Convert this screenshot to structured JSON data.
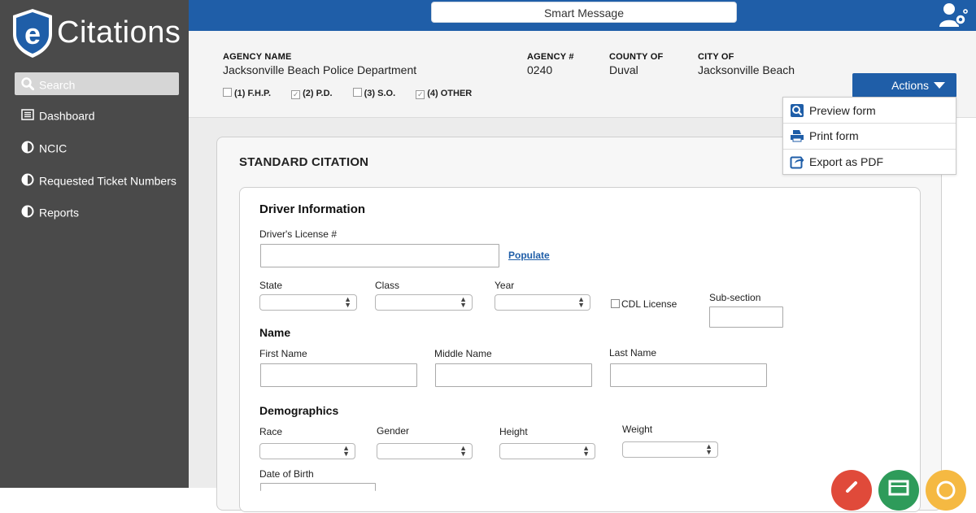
{
  "app": {
    "logo_letter": "e",
    "logo_text": "Citations",
    "brand_color": "#1f5ea8"
  },
  "sidebar": {
    "items": [
      {
        "label": "Search",
        "icon": "search-icon"
      },
      {
        "label": "Dashboard",
        "icon": "dashboard-icon"
      },
      {
        "label": "NCIC",
        "icon": "half-circle-icon"
      },
      {
        "label": "Requested Ticket Numbers",
        "icon": "half-circle-icon"
      },
      {
        "label": "Reports",
        "icon": "half-circle-icon"
      }
    ]
  },
  "topbar": {
    "smart_message": "Smart Message"
  },
  "agency": {
    "name_label": "AGENCY NAME",
    "name_value": "Jacksonville Beach Police Department",
    "number_label": "AGENCY #",
    "number_value": "0240",
    "county_label": "COUNTY OF",
    "county_value": "Duval",
    "city_label": "CITY OF",
    "city_value": "Jacksonville Beach",
    "checkboxes": [
      {
        "label": "(1) F.H.P.",
        "checked": false
      },
      {
        "label": "(2) P.D.",
        "checked": true
      },
      {
        "label": "(3) S.O.",
        "checked": false
      },
      {
        "label": "(4) OTHER",
        "checked": true
      }
    ]
  },
  "actions": {
    "label": "Actions",
    "menu": [
      {
        "label": "Preview form",
        "icon": "preview-icon"
      },
      {
        "label": "Print form",
        "icon": "print-icon"
      },
      {
        "label": "Export as PDF",
        "icon": "export-icon"
      }
    ]
  },
  "form": {
    "title": "STANDARD CITATION",
    "driver": {
      "heading": "Driver Information",
      "license_label": "Driver's License #",
      "license_value": "",
      "populate": "Populate",
      "state_label": "State",
      "class_label": "Class",
      "year_label": "Year",
      "cdl_label": "CDL License",
      "subsection_label": "Sub-section"
    },
    "name": {
      "heading": "Name",
      "first_label": "First Name",
      "middle_label": "Middle Name",
      "last_label": "Last Name"
    },
    "demographics": {
      "heading": "Demographics",
      "race_label": "Race",
      "gender_label": "Gender",
      "height_label": "Height",
      "weight_label": "Weight",
      "dob_label": "Date of Birth"
    }
  },
  "fabs": [
    {
      "color": "#e04a3a",
      "icon": "back-icon"
    },
    {
      "color": "#2e9b5a",
      "icon": "list-icon"
    },
    {
      "color": "#f5b942",
      "icon": "circle-icon"
    }
  ]
}
